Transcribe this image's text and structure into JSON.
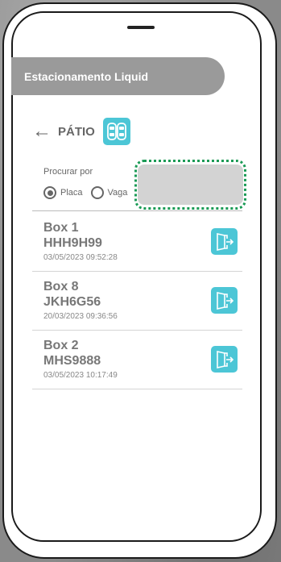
{
  "header": {
    "title": "Estacionamento Liquid"
  },
  "nav": {
    "back_icon": "arrow-left-icon",
    "title": "PÁTIO",
    "page_icon": "parking-cars-icon"
  },
  "search": {
    "label": "Procurar por",
    "options": [
      {
        "label": "Placa",
        "selected": true
      },
      {
        "label": "Vaga",
        "selected": false
      }
    ],
    "value": ""
  },
  "entries": [
    {
      "box": "Box 1",
      "plate": "HHH9H99",
      "datetime": "03/05/2023 09:52:28"
    },
    {
      "box": "Box 8",
      "plate": "JKH6G56",
      "datetime": "20/03/2023 09:36:56"
    },
    {
      "box": "Box 2",
      "plate": "MHS9888",
      "datetime": "03/05/2023 10:17:49"
    }
  ],
  "colors": {
    "accent": "#4cc6d6",
    "header_bg": "#9a9a9a",
    "highlight": "#1a9a55"
  },
  "icons": {
    "exit": "exit-door-icon"
  }
}
